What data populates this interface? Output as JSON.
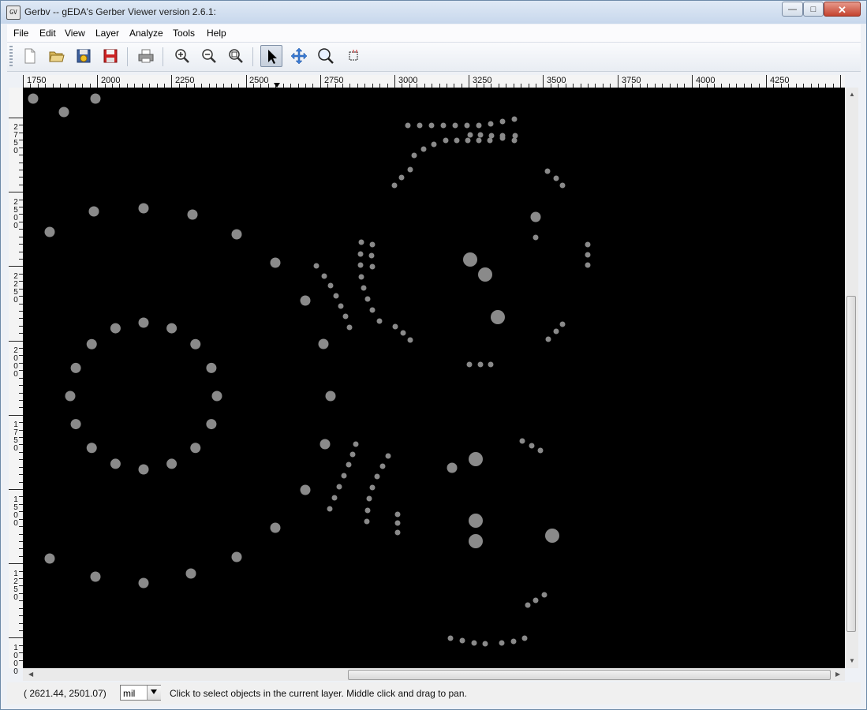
{
  "window": {
    "title": "Gerbv -- gEDA's Gerber Viewer version 2.6.1:",
    "app_icon": "gerbv-app-icon",
    "controls": {
      "minimize": "—",
      "maximize": "□",
      "close": "✕"
    }
  },
  "menu": {
    "items": [
      {
        "label": "File"
      },
      {
        "label": "Edit"
      },
      {
        "label": "View"
      },
      {
        "label": "Layer"
      },
      {
        "label": "Analyze"
      },
      {
        "label": "Tools"
      },
      {
        "label": "Help"
      }
    ]
  },
  "toolbar": {
    "buttons": [
      {
        "icon": "new-icon"
      },
      {
        "icon": "open-icon"
      },
      {
        "icon": "revert-icon"
      },
      {
        "icon": "save-icon"
      },
      {
        "icon": "print-icon"
      },
      {
        "icon": "zoom-in-icon"
      },
      {
        "icon": "zoom-out-icon"
      },
      {
        "icon": "zoom-fit-icon"
      },
      {
        "icon": "pointer-tool-icon"
      },
      {
        "icon": "pan-tool-icon"
      },
      {
        "icon": "zoom-tool-icon"
      },
      {
        "icon": "measure-tool-icon"
      }
    ],
    "active_tool": "pointer-tool-icon"
  },
  "ruler": {
    "horizontal": [
      "1750",
      "2000",
      "2250",
      "2500",
      "2750",
      "3000",
      "3250",
      "3500",
      "3750",
      "4000",
      "4250"
    ],
    "vertical": [
      [
        "2",
        "7",
        "5",
        "0"
      ],
      [
        "2",
        "5",
        "0",
        "0"
      ],
      [
        "2",
        "2",
        "5",
        "0"
      ],
      [
        "2",
        "0",
        "0",
        "0"
      ],
      [
        "1",
        "7",
        "5",
        "0"
      ],
      [
        "1",
        "5",
        "0",
        "0"
      ],
      [
        "1",
        "2",
        "5",
        "0"
      ],
      [
        "1",
        "0",
        "0",
        "0"
      ]
    ]
  },
  "canvas": {
    "background": "#000000",
    "pad_color": "#8a8a8a"
  },
  "status": {
    "coords": "( 2621.44,  2501.07)",
    "unit": "mil",
    "message": "Click to select objects in the current layer. Middle click and drag to pan."
  }
}
